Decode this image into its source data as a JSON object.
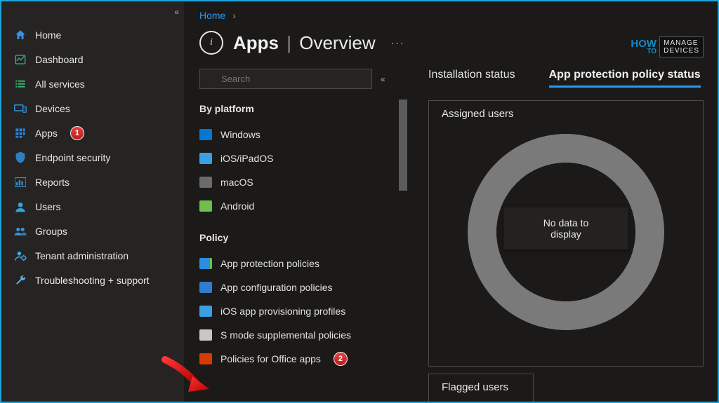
{
  "sidebar": {
    "items": [
      {
        "id": "home",
        "label": "Home"
      },
      {
        "id": "dashboard",
        "label": "Dashboard"
      },
      {
        "id": "all-services",
        "label": "All services"
      },
      {
        "id": "devices",
        "label": "Devices"
      },
      {
        "id": "apps",
        "label": "Apps",
        "badge": "1"
      },
      {
        "id": "endpoint-security",
        "label": "Endpoint security"
      },
      {
        "id": "reports",
        "label": "Reports"
      },
      {
        "id": "users",
        "label": "Users"
      },
      {
        "id": "groups",
        "label": "Groups"
      },
      {
        "id": "tenant-admin",
        "label": "Tenant administration"
      },
      {
        "id": "troubleshoot",
        "label": "Troubleshooting + support"
      }
    ]
  },
  "breadcrumb": {
    "home": "Home"
  },
  "header": {
    "title_main": "Apps",
    "title_sub": "Overview"
  },
  "search": {
    "placeholder": "Search"
  },
  "nav": {
    "section1": "By platform",
    "platform": [
      {
        "label": "Windows"
      },
      {
        "label": "iOS/iPadOS"
      },
      {
        "label": "macOS"
      },
      {
        "label": "Android"
      }
    ],
    "section2": "Policy",
    "policy": [
      {
        "label": "App protection policies"
      },
      {
        "label": "App configuration policies"
      },
      {
        "label": "iOS app provisioning profiles"
      },
      {
        "label": "S mode supplemental policies"
      },
      {
        "label": "Policies for Office apps",
        "badge": "2"
      }
    ]
  },
  "tabs": {
    "installation": "Installation status",
    "protection": "App protection policy status"
  },
  "cards": {
    "assigned_title": "Assigned users",
    "no_data": "No data to display",
    "flagged_title": "Flagged users"
  },
  "logo": {
    "how": "HOW",
    "to": "TO",
    "manage": "MANAGE",
    "devices": "DEVICES"
  }
}
